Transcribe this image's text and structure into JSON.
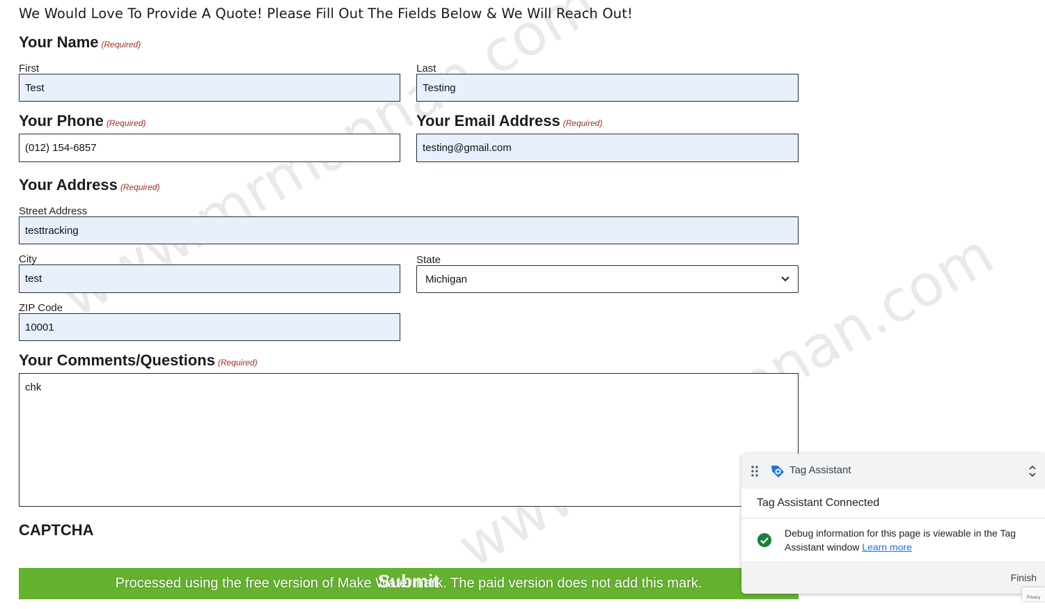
{
  "form": {
    "heading": "We Would Love To Provide A Quote! Please Fill Out The Fields Below & We Will Reach Out!",
    "required_tag": "(Required)",
    "name": {
      "label": "Your Name",
      "first_label": "First",
      "first_value": "Test",
      "last_label": "Last",
      "last_value": "Testing"
    },
    "phone": {
      "label": "Your Phone",
      "value": "(012) 154-6857"
    },
    "email": {
      "label": "Your Email Address",
      "value": "testing@gmail.com"
    },
    "address": {
      "label": "Your Address",
      "street_label": "Street Address",
      "street_value": "testtracking",
      "city_label": "City",
      "city_value": "test",
      "state_label": "State",
      "state_value": "Michigan",
      "zip_label": "ZIP Code",
      "zip_value": "10001"
    },
    "comments": {
      "label": "Your Comments/Questions",
      "value": "chk"
    },
    "captcha_label": "CAPTCHA",
    "submit_label": "Submit"
  },
  "watermark": {
    "site_text": "www.mrmannan.com",
    "bar_text": "Processed using the free version of Make Watermark. The paid version does not add this mark."
  },
  "tag_assistant": {
    "title": "Tag Assistant",
    "status": "Tag Assistant Connected",
    "debug_text": "Debug information for this page is viewable in the Tag Assistant window",
    "learn_more": "Learn more",
    "finish": "Finish",
    "brand_color": "#1a73e8",
    "success_color": "#188038"
  },
  "recaptcha": {
    "privacy": "Privacy"
  }
}
